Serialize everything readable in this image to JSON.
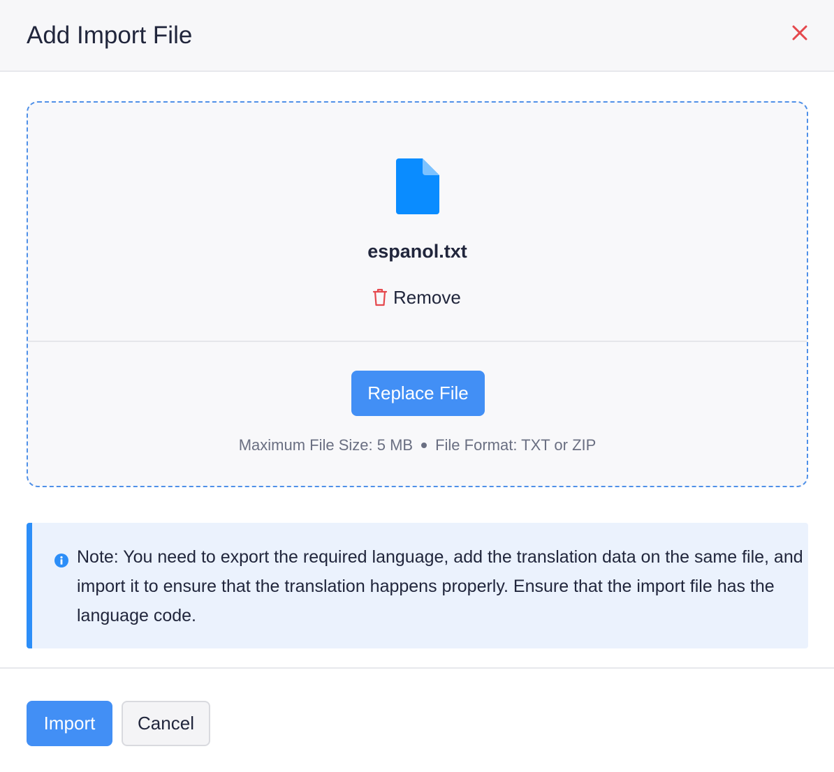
{
  "dialog": {
    "title": "Add Import File",
    "close_icon": "close-icon"
  },
  "dropzone": {
    "file_icon": "document-file-icon",
    "file_name": "espanol.txt",
    "remove_label": "Remove",
    "remove_icon": "trash-icon",
    "replace_label": "Replace File",
    "max_size_text": "Maximum File Size: 5 MB",
    "format_text": "File Format: TXT or ZIP"
  },
  "note": {
    "icon": "info-icon",
    "text": "Note: You need to export the required language, add the translation data on the same file, and import it to ensure that the translation happens properly. Ensure that the import file has the language code."
  },
  "footer": {
    "import_label": "Import",
    "cancel_label": "Cancel"
  },
  "colors": {
    "accent": "#428ff5",
    "close": "#e5484d",
    "remove_icon": "#e5484d",
    "note_bg": "#ebf2fd",
    "note_border": "#2c8ef8",
    "dropzone_border": "#4f90e8"
  }
}
